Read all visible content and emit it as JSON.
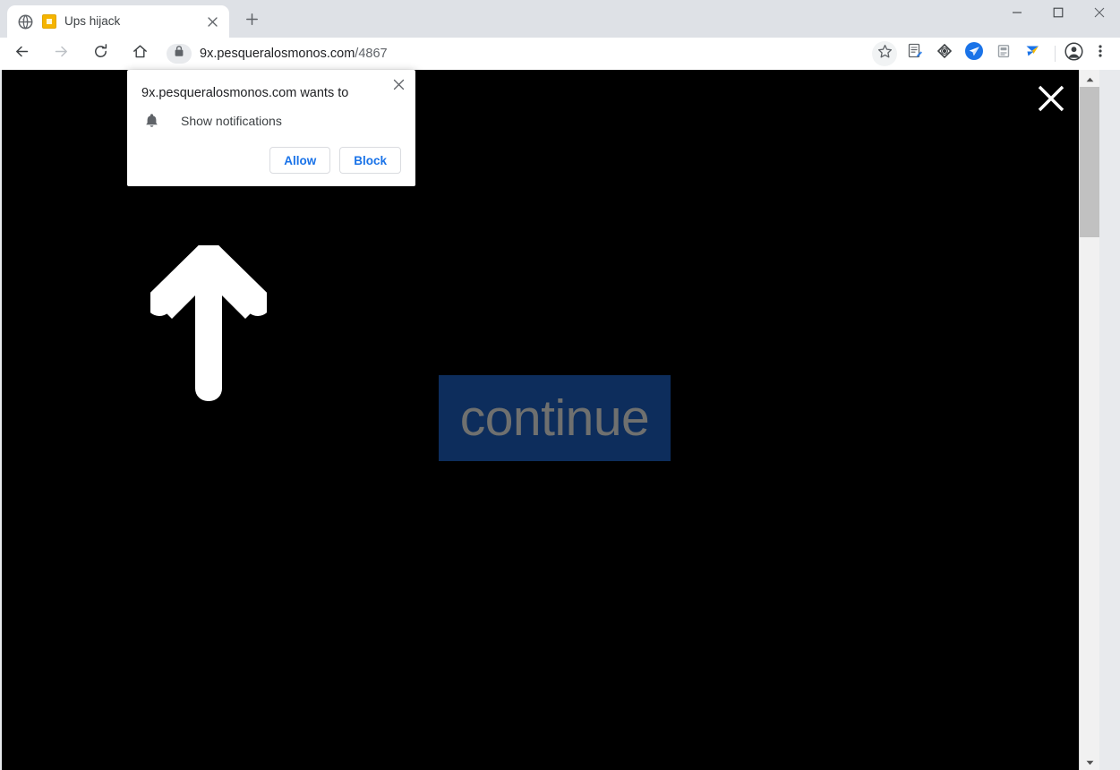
{
  "window": {
    "controls": {
      "minimize": "minimize-icon",
      "maximize": "maximize-icon",
      "close": "close-icon"
    }
  },
  "tabstrip": {
    "tabs": [
      {
        "title": "Ups hijack",
        "favicon": "yellow-square-favicon",
        "globe_icon": "globe-icon",
        "close_icon": "close-icon",
        "active": true
      }
    ],
    "new_tab_label": "+",
    "new_tab_icon": "plus-icon"
  },
  "toolbar": {
    "back_icon": "back-arrow-icon",
    "forward_icon": "forward-arrow-icon",
    "reload_icon": "reload-icon",
    "home_icon": "home-icon",
    "lock_icon": "lock-icon",
    "url_host": "9x.pesqueralosmonos.com",
    "url_path": "/4867",
    "url_full": "9x.pesqueralosmonos.com/4867",
    "star_icon": "star-bookmark-icon",
    "extensions": [
      {
        "name": "document-edit-icon"
      },
      {
        "name": "diamond-node-icon"
      },
      {
        "name": "paper-plane-icon"
      },
      {
        "name": "archive-box-icon"
      },
      {
        "name": "lightning-arrow-icon"
      }
    ],
    "profile_icon": "profile-avatar-icon",
    "menu_icon": "three-dot-menu-icon"
  },
  "permission_bubble": {
    "title": "9x.pesqueralosmonos.com wants to",
    "close_icon": "close-icon",
    "request_icon": "bell-icon",
    "request_label": "Show notifications",
    "allow_label": "Allow",
    "block_label": "Block",
    "accent_color": "#1a73e8"
  },
  "page": {
    "background_color": "#000000",
    "close_icon": "close-x-icon",
    "arrow_icon": "up-arrow-icon",
    "continue_label": "continue",
    "continue_bg_color": "#0d2d5c",
    "continue_text_color": "#6f706f"
  },
  "scrollbar": {
    "up_icon": "scroll-up-arrow-icon",
    "down_icon": "scroll-down-arrow-icon"
  }
}
